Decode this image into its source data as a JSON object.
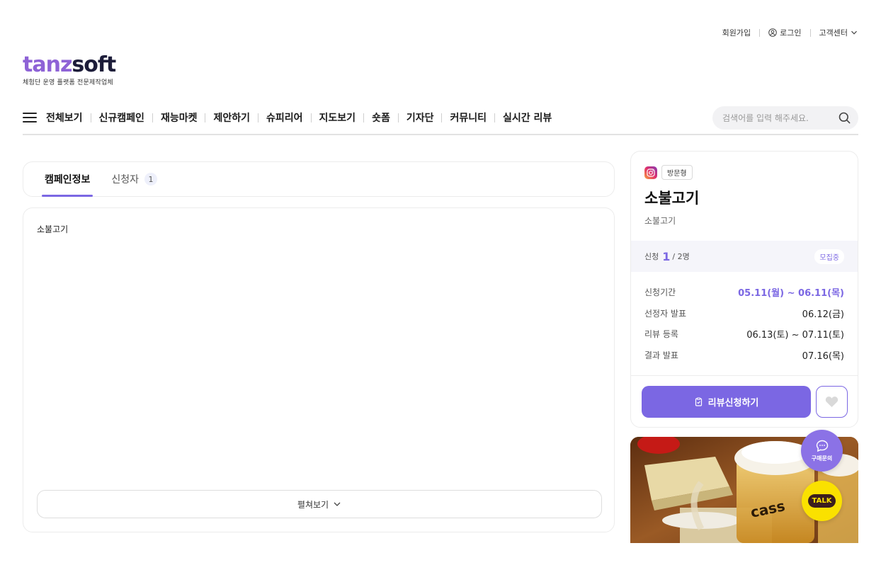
{
  "header": {
    "links": {
      "signup": "회원가입",
      "login": "로그인",
      "support": "고객센터"
    },
    "logo": {
      "word_a": "tanz",
      "word_b": "soft",
      "tagline": "체험단 운영 플랫폼 전문제작업체"
    },
    "nav": [
      "전체보기",
      "신규캠페인",
      "재능마켓",
      "제안하기",
      "슈피리어",
      "지도보기",
      "숏폼",
      "기자단",
      "커뮤니티",
      "실시간 리뷰"
    ],
    "search": {
      "placeholder": "검색어를 입력 해주세요."
    }
  },
  "tabs": {
    "info": "캠페인정보",
    "applicants": "신청자",
    "applicants_count": "1"
  },
  "content": {
    "description": "소불고기",
    "expand_label": "펼쳐보기"
  },
  "campaign": {
    "type_badge": "방문형",
    "title": "소불고기",
    "subtitle": "소불고기",
    "apply_label": "신청",
    "apply_count": "1",
    "apply_total": "/ 2명",
    "status": "모집중",
    "schedule": [
      {
        "label": "신청기간",
        "value": "05.11(월) ~ 06.11(목)",
        "highlight": true
      },
      {
        "label": "선정자 발표",
        "value": "06.12(금)",
        "highlight": false
      },
      {
        "label": "리뷰 등록",
        "value": "06.13(토) ~ 07.11(토)",
        "highlight": false
      },
      {
        "label": "결과 발표",
        "value": "07.16(목)",
        "highlight": false
      }
    ],
    "apply_button": "리뷰신청하기"
  },
  "floating": {
    "inquiry": "구매문의",
    "talk": "TALK"
  },
  "colors": {
    "accent": "#7b67e3",
    "brand_purple": "#8e63d6",
    "brand_dark": "#1d1d3a",
    "kakao": "#fae100"
  }
}
